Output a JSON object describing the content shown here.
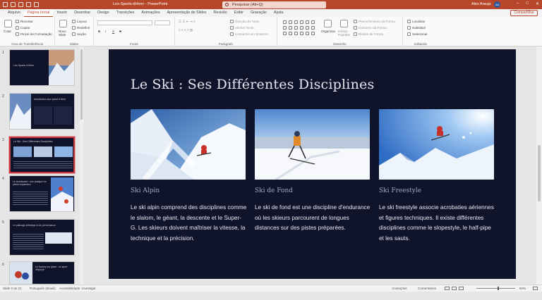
{
  "titlebar": {
    "document": "Les-Sports-dHiver  -  PowerPoint",
    "search_placeholder": "Pesquisar (Alt+Q)",
    "user": "Alex Araujo",
    "avatar_initials": "AA"
  },
  "menu": {
    "tabs": [
      "Arquivo",
      "Página Inicial",
      "Inserir",
      "Desenhar",
      "Design",
      "Transições",
      "Animações",
      "Apresentação de Slides",
      "Revisão",
      "Exibir",
      "Gravação",
      "Ajuda"
    ],
    "active": "Página Inicial",
    "share_label": "Compartilhar"
  },
  "ribbon": {
    "clipboard": {
      "paste": "Colar",
      "cut": "Recortar",
      "copy": "Copiar",
      "format": "Pincel de Formatação",
      "label": "Área de Transferência"
    },
    "slides": {
      "new": "Novo Slide",
      "layout": "Layout",
      "reset": "Redefinir",
      "section": "Seção",
      "label": "Slides"
    },
    "font": {
      "label": "Fonte",
      "bold": "N",
      "italic": "I",
      "underline": "S",
      "strike": "S"
    },
    "paragraph": {
      "text_direction": "Direção do Texto",
      "align_text": "Alinhar Texto",
      "smartart": "Converter em SmartArt",
      "label": "Parágrafo"
    },
    "drawing": {
      "arrange": "Organizar",
      "quick_styles": "Estilos Rápidos",
      "fill": "Preenchimento da Forma",
      "outline": "Contorno da Forma",
      "effects": "Efeitos de Forma",
      "label": "Desenho"
    },
    "editing": {
      "find": "Localizar",
      "replace": "Substituir",
      "select": "Selecionar",
      "label": "Editando"
    }
  },
  "thumbnails": [
    {
      "num": "1",
      "title": "Les Sports d'Hiver"
    },
    {
      "num": "2",
      "title": "Introduction aux sports d'hiver"
    },
    {
      "num": "3",
      "title": "Le Ski : Ses Différentes Disciplines"
    },
    {
      "num": "4",
      "title": "Le snowboard : une pratique en pleine expansion"
    },
    {
      "num": "5",
      "title": "Le patinage artistique et de performance"
    },
    {
      "num": "6",
      "title": "Le hockey sur glace : un sport d'équipe"
    }
  ],
  "slide": {
    "title": "Le Ski : Ses Différentes Disciplines",
    "cards": [
      {
        "heading": "Ski Alpin",
        "body": "Le ski alpin comprend des disciplines comme le slalom, le géant, la descente et le Super-G. Les skieurs doivent maîtriser la vitesse, la technique et la précision."
      },
      {
        "heading": "Ski de Fond",
        "body": "Le ski de fond est une discipline d'endurance où les skieurs parcourent de longues distances sur des pistes préparées."
      },
      {
        "heading": "Ski Freestyle",
        "body": "Le ski freestyle associe acrobaties aériennes et figures techniques. Il existe différentes disciplines comme le slopestyle, le half-pipe et les sauts."
      }
    ]
  },
  "status": {
    "slide_counter": "Slide 3 de 21",
    "language": "Português (Brasil)",
    "accessibility": "Acessibilidade: investigar",
    "notes": "Anotações",
    "comments": "Comentários",
    "zoom": "94%"
  },
  "colors": {
    "accent": "#b7472a",
    "slide_bg": "#10142b",
    "heading": "#a0a4c4"
  }
}
